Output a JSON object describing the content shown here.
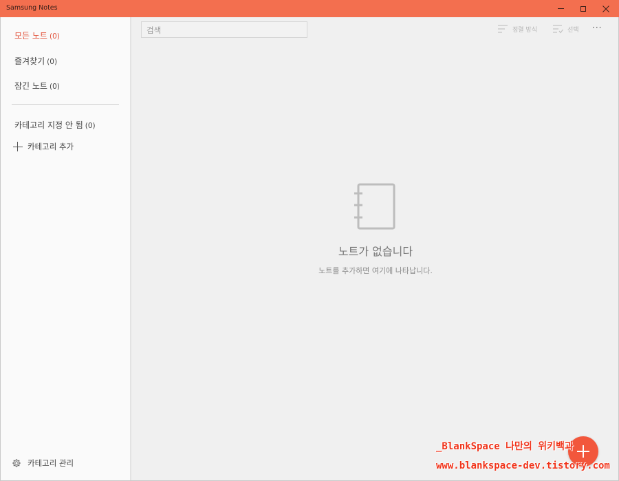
{
  "window": {
    "title": "Samsung Notes"
  },
  "sidebar": {
    "items": [
      {
        "label": "모든 노트",
        "count": "(0)"
      },
      {
        "label": "즐겨찾기",
        "count": "(0)"
      },
      {
        "label": "잠긴 노트",
        "count": "(0)"
      },
      {
        "label": "카테고리 지정 안 됨",
        "count": "(0)"
      }
    ],
    "add_category": "카테고리 추가",
    "manage_categories": "카테고리 관리"
  },
  "toolbar": {
    "search_placeholder": "검색",
    "sort_label": "정렬 방식",
    "select_label": "선택",
    "more_label": "···"
  },
  "empty_state": {
    "title": "노트가 없습니다",
    "subtitle": "노트를 추가하면 여기에 나타납니다."
  },
  "watermark": {
    "line1": "_BlankSpace 나만의 위키백과",
    "line2": "www.blankspace-dev.tistory.com"
  },
  "colors": {
    "accent": "#f36f4f",
    "active_text": "#e2523b",
    "fab": "#f2573c"
  }
}
